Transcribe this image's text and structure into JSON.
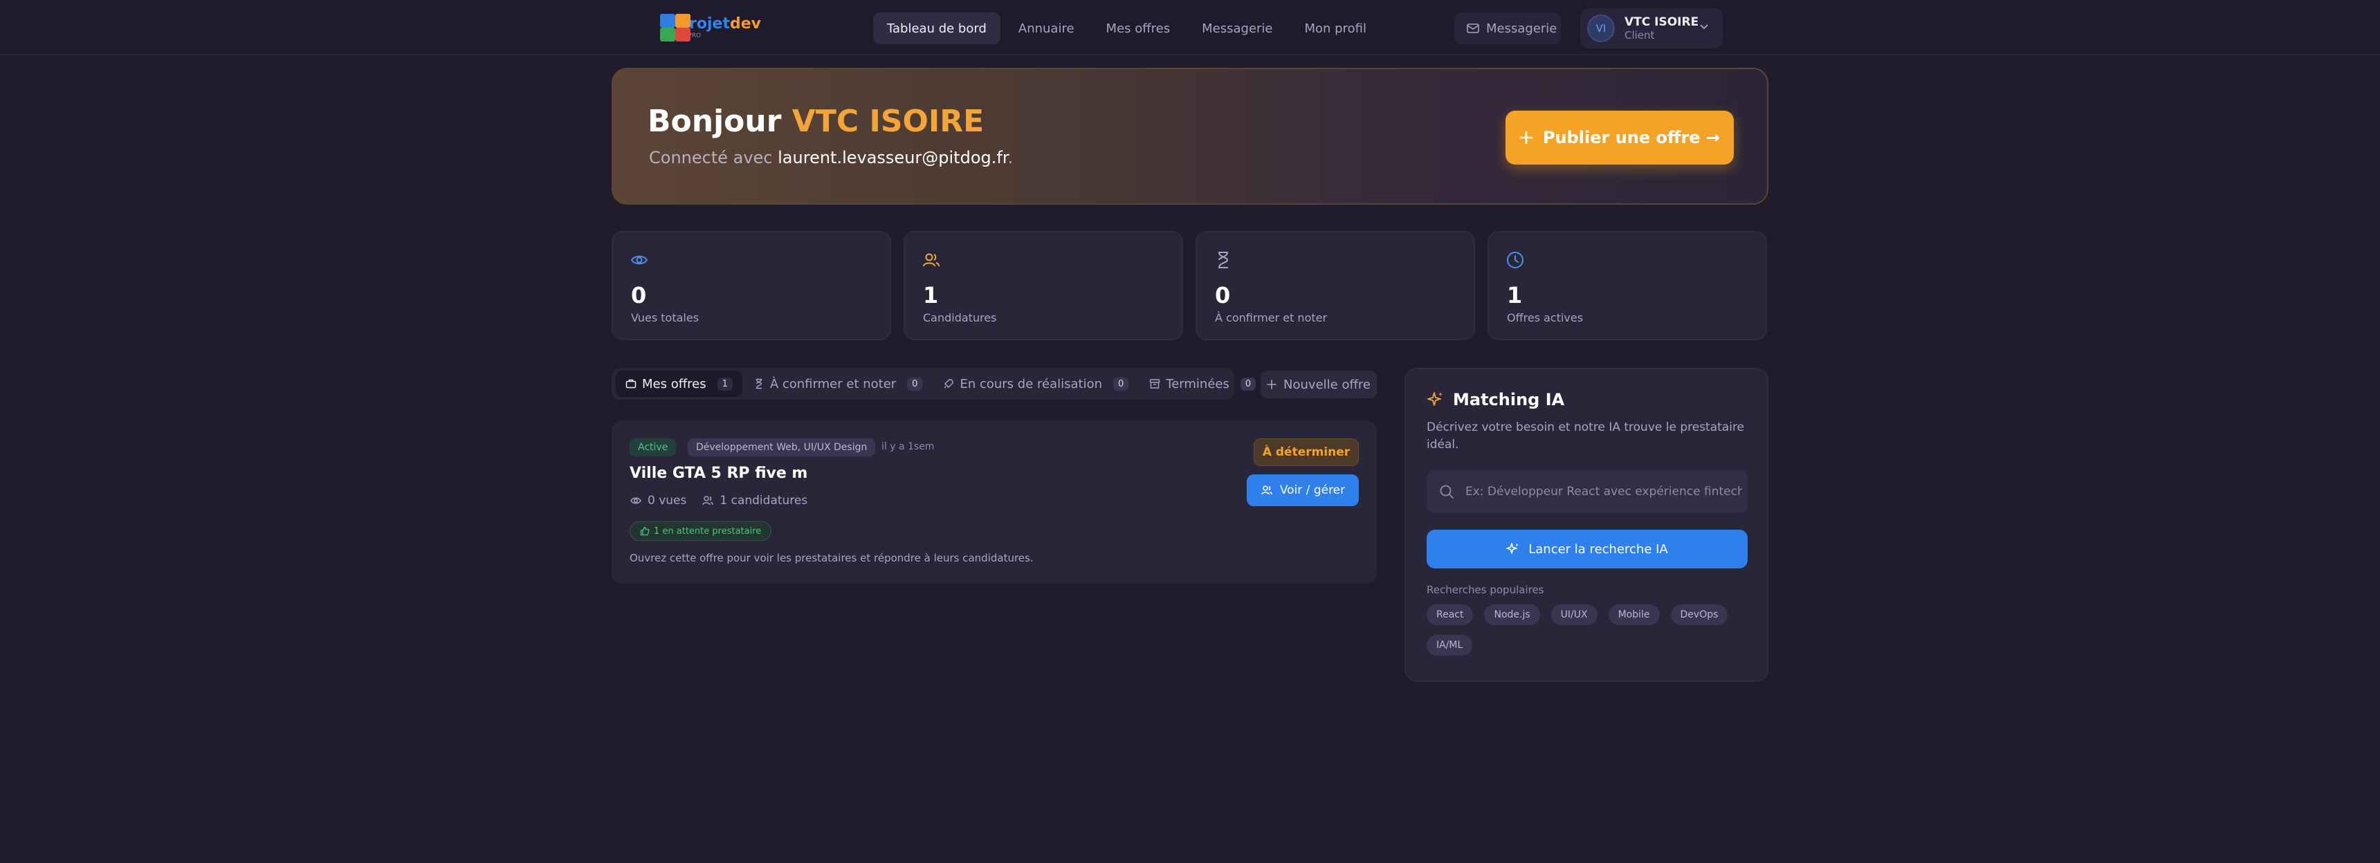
{
  "brand": {
    "logo_text_main": "projet",
    "logo_text_accent": "dev",
    "logo_tagline": "PRO"
  },
  "nav": {
    "links": [
      {
        "label": "Tableau de bord",
        "active": true
      },
      {
        "label": "Annuaire",
        "active": false
      },
      {
        "label": "Mes offres",
        "active": false
      },
      {
        "label": "Messagerie",
        "active": false
      },
      {
        "label": "Mon profil",
        "active": false
      }
    ],
    "messages_label": "Messagerie",
    "user": {
      "initials": "VI",
      "name": "VTC ISOIRE",
      "role": "Client"
    }
  },
  "hero": {
    "greeting": "Bonjour",
    "company": "VTC ISOIRE",
    "connected_prefix": "Connecté avec",
    "email": "laurent.levasseur@pitdog.fr",
    "connected_suffix": ".",
    "publish_label": "Publier une offre →"
  },
  "stats": [
    {
      "icon": "eye-icon",
      "value": "0",
      "label": "Vues totales",
      "color": "#4d8fe8"
    },
    {
      "icon": "users-icon",
      "value": "1",
      "label": "Candidatures",
      "color": "#f4a53a"
    },
    {
      "icon": "hourglass-icon",
      "value": "0",
      "label": "À confirmer et noter",
      "color": "#a9a4bd"
    },
    {
      "icon": "clock-icon",
      "value": "1",
      "label": "Offres actives",
      "color": "#4d8fe8"
    }
  ],
  "tabs": [
    {
      "label": "Mes offres",
      "count": "1",
      "active": true
    },
    {
      "label": "À confirmer et noter",
      "count": "0",
      "active": false
    },
    {
      "label": "En cours de réalisation",
      "count": "0",
      "active": false
    },
    {
      "label": "Terminées",
      "count": "0",
      "active": false
    }
  ],
  "new_offer_label": "Nouvelle offre",
  "offer": {
    "status": "Active",
    "category": "Développement Web, UI/UX Design",
    "time": "il y a 1sem",
    "title": "Ville GTA 5 RP five m",
    "views": "0 vues",
    "applications": "1 candidatures",
    "waiting": "1 en attente prestataire",
    "hint": "Ouvrez cette offre pour voir les prestataires et répondre à leurs candidatures.",
    "price": "À déterminer",
    "manage_label": "Voir / gérer"
  },
  "ia": {
    "title": "Matching IA",
    "description": "Décrivez votre besoin et notre IA trouve le prestataire idéal.",
    "placeholder": "Ex: Développeur React avec expérience fintech...",
    "button_label": "Lancer la recherche IA",
    "popular_label": "Recherches populaires",
    "tags": [
      "React",
      "Node.js",
      "UI/UX",
      "Mobile",
      "DevOps",
      "IA/ML"
    ]
  },
  "colors": {
    "accent_orange": "#f5a326",
    "accent_blue": "#2f80ed",
    "success_green": "#4fc28f",
    "background": "#201c2e"
  }
}
